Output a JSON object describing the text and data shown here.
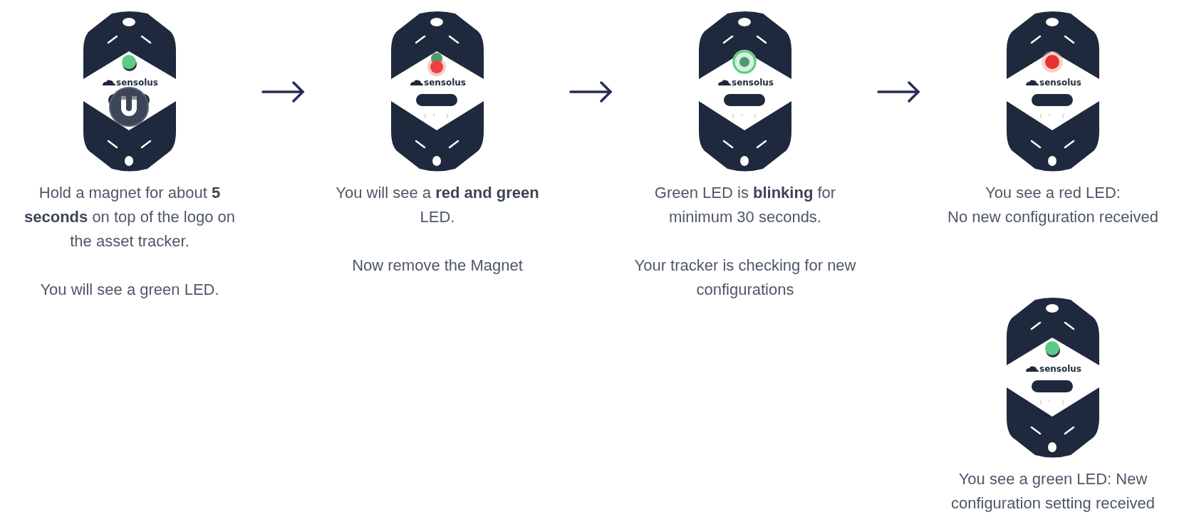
{
  "steps": [
    {
      "outcomes": [
        {
          "device": {
            "green_led": true,
            "red_led": false,
            "blinking": false,
            "magnet": true,
            "logo": "sensolus"
          },
          "paragraphs": [
            "Hold a magnet for about **5 seconds** on top of the logo on the asset tracker.",
            "You will see a green LED."
          ]
        }
      ]
    },
    {
      "outcomes": [
        {
          "device": {
            "green_led": true,
            "red_led": true,
            "blinking": false,
            "magnet": false,
            "logo": "sensolus"
          },
          "paragraphs": [
            "You will see a **red and green** LED.",
            "Now remove the Magnet"
          ]
        }
      ]
    },
    {
      "outcomes": [
        {
          "device": {
            "green_led": true,
            "red_led": false,
            "blinking": true,
            "magnet": false,
            "logo": "sensolus"
          },
          "paragraphs": [
            "Green LED is **blinking** for minimum 30 seconds.",
            "Your tracker is checking for new configurations"
          ]
        }
      ]
    },
    {
      "outcomes": [
        {
          "device": {
            "green_led": false,
            "red_led": true,
            "blinking": false,
            "magnet": false,
            "logo": "sensolus"
          },
          "paragraphs": [
            "You see a red LED:\nNo new configuration received"
          ]
        },
        {
          "device": {
            "green_led": true,
            "red_led": false,
            "blinking": false,
            "magnet": false,
            "logo": "sensolus"
          },
          "paragraphs": [
            "You see a green LED: New configuration setting received"
          ]
        }
      ]
    }
  ]
}
